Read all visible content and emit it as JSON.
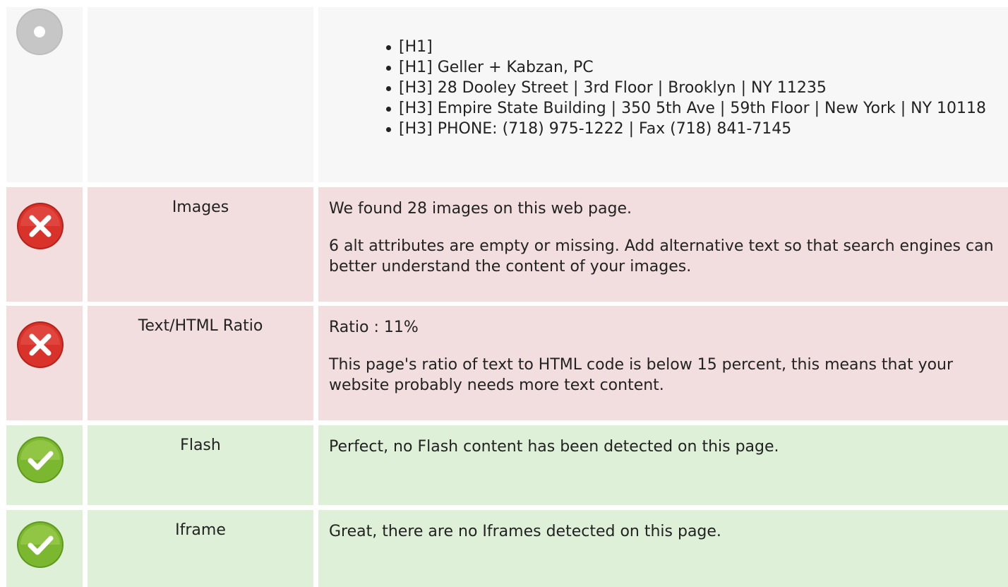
{
  "headings": {
    "items": [
      "[H1]",
      "[H1] Geller + Kabzan, PC",
      "[H3] 28 Dooley Street | 3rd Floor | Brooklyn | NY 11235",
      "[H3] Empire State Building | 350 5th Ave | 59th Floor | New York | NY 10118",
      "[H3] PHONE: (718) 975-1222 | Fax (718) 841-7145"
    ]
  },
  "images": {
    "label": "Images",
    "status_icon": "error-icon",
    "line1": "We found 28 images on this web page.",
    "line2": "6 alt attributes are empty or missing. Add alternative text so that search engines can better understand the content of your images."
  },
  "ratio": {
    "label": "Text/HTML Ratio",
    "status_icon": "error-icon",
    "line1": "Ratio : 11%",
    "line2": "This page's ratio of text to HTML code is below 15 percent, this means that your website probably needs more text content."
  },
  "flash": {
    "label": "Flash",
    "status_icon": "check-icon",
    "line1": "Perfect, no Flash content has been detected on this page."
  },
  "iframe": {
    "label": "Iframe",
    "status_icon": "check-icon",
    "line1": "Great, there are no Iframes detected on this page."
  },
  "colors": {
    "neutral_bg": "#f7f7f7",
    "error_bg": "#f2dede",
    "ok_bg": "#dff0d8",
    "error_icon": "#d9322a",
    "ok_icon": "#7cb82f"
  }
}
